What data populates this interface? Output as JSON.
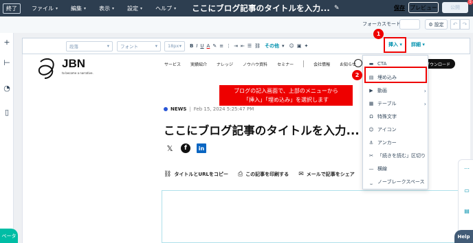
{
  "topbar": {
    "exit_label": "終了",
    "menu": [
      {
        "label": "ファイル"
      },
      {
        "label": "編集"
      },
      {
        "label": "表示"
      },
      {
        "label": "設定"
      },
      {
        "label": "ヘルプ"
      }
    ],
    "title": "ここにブログ記事のタイトルを入力...",
    "save_label": "保存",
    "preview_label": "プレビュー",
    "publish_label": "公開",
    "notification_count": "1"
  },
  "subbar": {
    "focus_mode_label": "フォーカスモード",
    "settings_label": "設定"
  },
  "toolbar": {
    "paragraph_placeholder": "段落",
    "font_placeholder": "フォント",
    "size_placeholder": "18px",
    "bold": "B",
    "italic": "I",
    "underline": "U",
    "text_color": "A",
    "other_label": "その他",
    "insert_label": "挿入",
    "detail_label": "詳細"
  },
  "site": {
    "logo_text": "JBN",
    "tagline": "to become a narrative.",
    "nav": [
      "サービス",
      "実績紹介",
      "ナレッジ",
      "ノウハウ資料",
      "セミナー",
      "会社情報",
      "お知らせ"
    ],
    "download_label": "ダウンロード"
  },
  "annotation": {
    "line1": "ブログの記入画面で、上部のメニューから",
    "line2": "「挿入」「埋め込み」を選択します"
  },
  "post": {
    "category": "NEWS",
    "separator": "|",
    "date": "Feb 15, 2024 5:25:47 PM",
    "title": "ここにブログ記事のタイトルを入力...",
    "social_x": "𝕏",
    "social_fb": "f",
    "social_li": "in",
    "actions": [
      {
        "label": "タイトルとURLをコピー"
      },
      {
        "label": "この記事を印刷する"
      },
      {
        "label": "メールで記事をシェア"
      }
    ]
  },
  "insert_menu": [
    {
      "label": "CTA",
      "icon": "cta-icon"
    },
    {
      "label": "埋め込み",
      "icon": "embed-icon"
    },
    {
      "label": "動画",
      "icon": "video-icon",
      "submenu": true
    },
    {
      "label": "テーブル",
      "icon": "table-icon",
      "submenu": true
    },
    {
      "label": "特殊文字",
      "icon": "omega-icon"
    },
    {
      "label": "アイコン",
      "icon": "smile-icon"
    },
    {
      "label": "アンカー",
      "icon": "anchor-icon"
    },
    {
      "label": "「続きを読む」区切り",
      "icon": "scissors-icon"
    },
    {
      "label": "横線",
      "icon": "hr-icon"
    },
    {
      "label": "ノーブレークスペース",
      "icon": "nbsp-icon"
    }
  ],
  "badges": {
    "step1": "1",
    "step2": "2"
  },
  "beta_label": "ベータ",
  "help_label": "Help",
  "colors": {
    "topbar": "#2d3e50",
    "accent": "#0091ae",
    "highlight": "#ee0000",
    "beta": "#00bda5"
  }
}
